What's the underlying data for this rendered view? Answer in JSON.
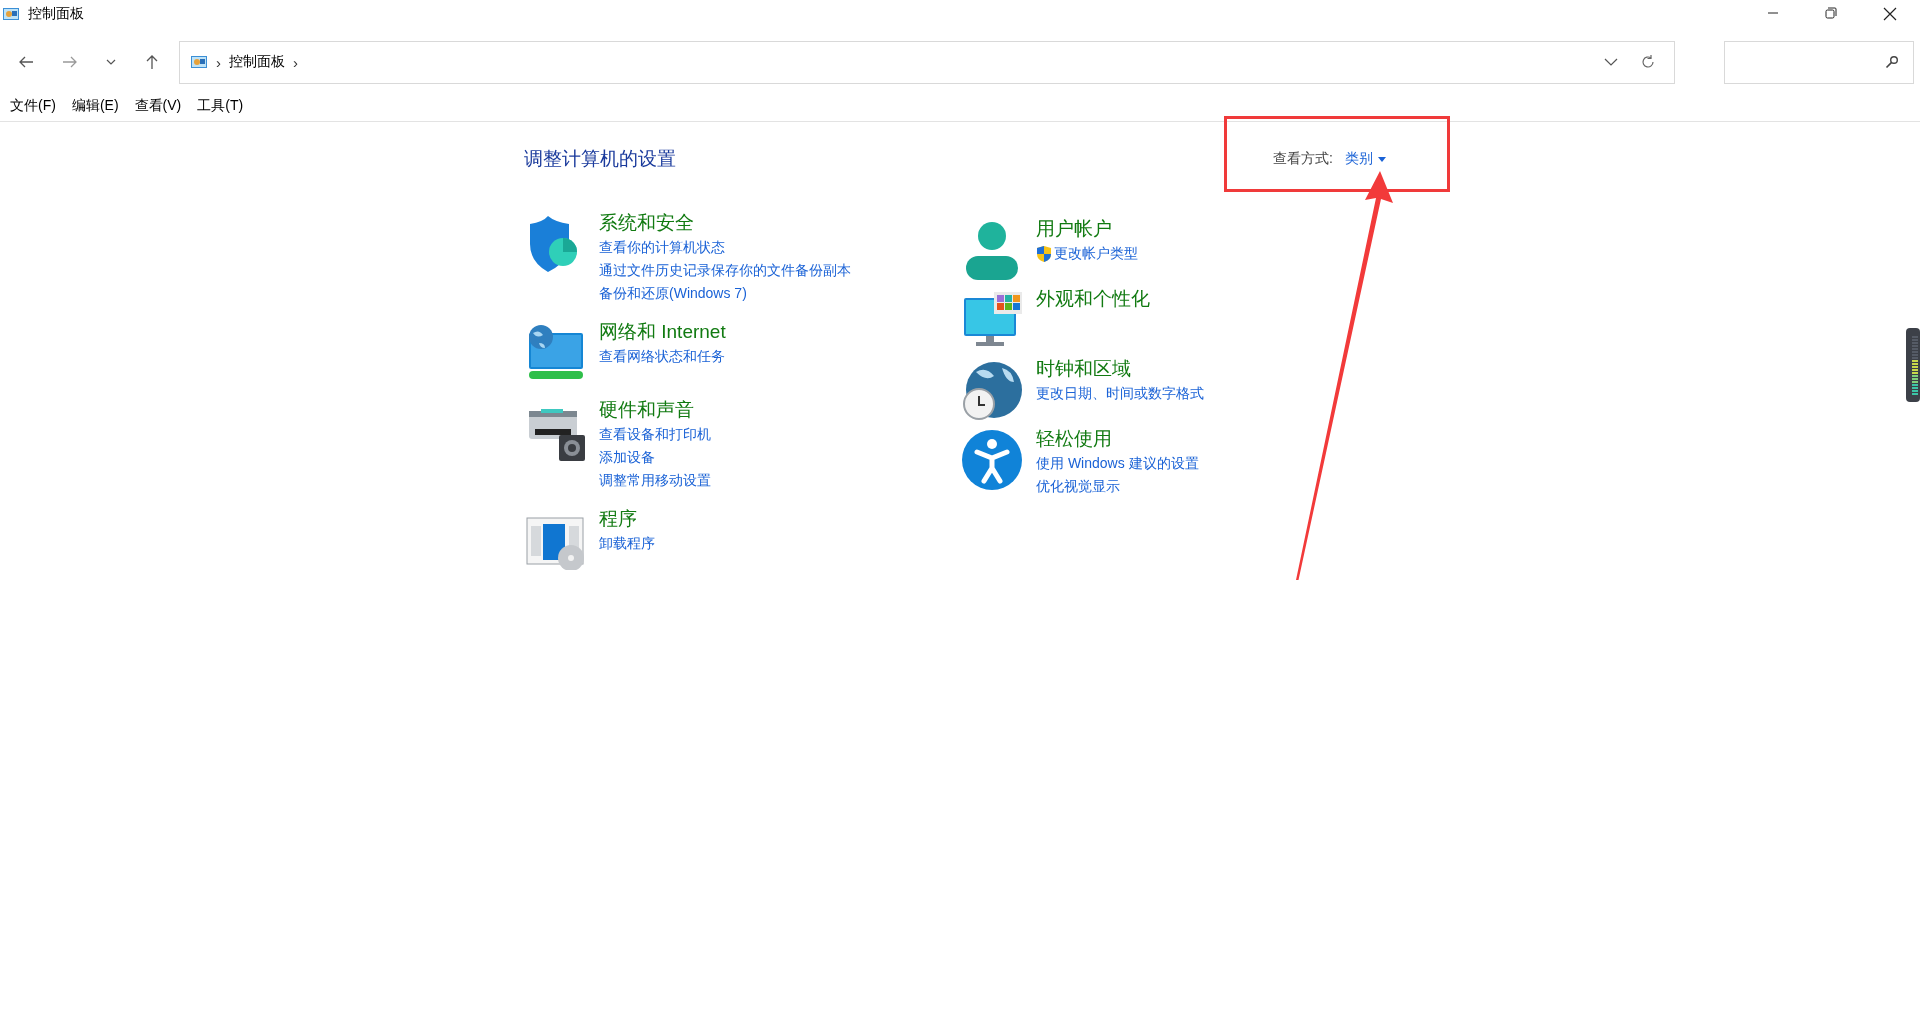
{
  "window": {
    "title": "控制面板"
  },
  "breadcrumb": [
    {
      "kind": "separator",
      "text": "›"
    },
    {
      "kind": "crumb",
      "text": "控制面板"
    },
    {
      "kind": "separator",
      "text": "›"
    }
  ],
  "menu": [
    "文件(F)",
    "编辑(E)",
    "查看(V)",
    "工具(T)"
  ],
  "heading": "调整计算机的设置",
  "view_by": {
    "label": "查看方式:",
    "value": "类别"
  },
  "columns": [
    [
      {
        "kind": "security",
        "title": "系统和安全",
        "links": [
          {
            "text": "查看你的计算机状态",
            "shield": false
          },
          {
            "text": "通过文件历史记录保存你的文件备份副本",
            "shield": false
          },
          {
            "text": "备份和还原(Windows 7)",
            "shield": false
          }
        ]
      },
      {
        "kind": "network",
        "title": "网络和 Internet",
        "links": [
          {
            "text": "查看网络状态和任务",
            "shield": false
          }
        ]
      },
      {
        "kind": "hardware",
        "title": "硬件和声音",
        "links": [
          {
            "text": "查看设备和打印机",
            "shield": false
          },
          {
            "text": "添加设备",
            "shield": false
          },
          {
            "text": "调整常用移动设置",
            "shield": false
          }
        ]
      },
      {
        "kind": "programs",
        "title": "程序",
        "links": [
          {
            "text": "卸载程序",
            "shield": false
          }
        ]
      }
    ],
    [
      {
        "kind": "user",
        "title": "用户帐户",
        "links": [
          {
            "text": "更改帐户类型",
            "shield": true
          }
        ]
      },
      {
        "kind": "appearance",
        "title": "外观和个性化"
      },
      {
        "kind": "clock",
        "title": "时钟和区域",
        "links": [
          {
            "text": "更改日期、时间或数字格式",
            "shield": false
          }
        ]
      },
      {
        "kind": "ease",
        "title": "轻松使用",
        "links": [
          {
            "text": "使用 Windows 建议的设置",
            "shield": false
          },
          {
            "text": "优化视觉显示",
            "shield": false
          }
        ]
      }
    ]
  ]
}
